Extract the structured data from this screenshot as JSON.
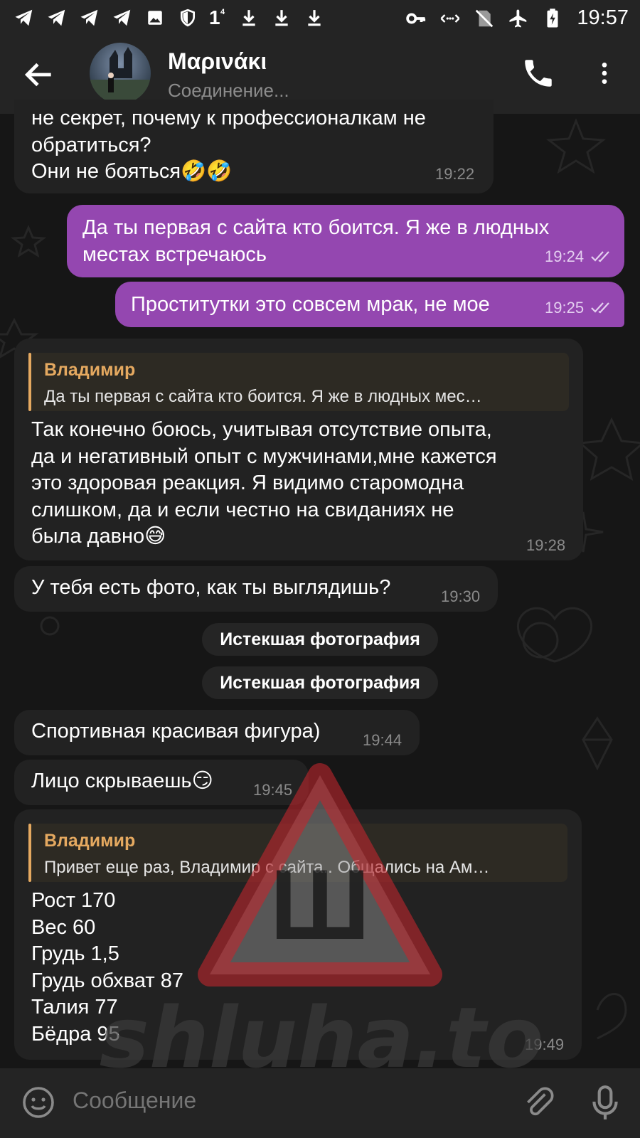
{
  "status_bar": {
    "time": "19:57",
    "signal_badge": "1",
    "signal_sup": "4",
    "icons_left": [
      "telegram-icon",
      "telegram-icon",
      "telegram-icon",
      "telegram-icon",
      "image-icon",
      "shield-icon",
      "signal-icon",
      "download-icon",
      "download-icon",
      "download-icon"
    ],
    "icons_right": [
      "key-icon",
      "data-transfer-icon",
      "no-sim-icon",
      "airplane-icon",
      "battery-charging-icon"
    ]
  },
  "header": {
    "name": "Μαρινάκι",
    "status": "Соединение..."
  },
  "messages": [
    {
      "dir": "in",
      "text": "не секрет, почему к профессионалкам не\nобратиться?\nОни не бояться",
      "emoji": "🤣🤣",
      "time": "19:22"
    },
    {
      "dir": "out",
      "text": "Да ты первая с сайта кто боится. Я же в людных\nместах встречаюсь",
      "time": "19:24"
    },
    {
      "dir": "out",
      "text": "Проститутки это совсем мрак, не мое",
      "time": "19:25"
    },
    {
      "dir": "in",
      "reply_name": "Владимир",
      "reply_text": "Да ты первая с сайта кто боится. Я же в людных мес…",
      "text": "Так конечно боюсь, учитывая отсутствие опыта,\nда и негативный опыт с мужчинами,мне кажется\nэто здоровая реакция. Я видимо старомодна\nслишком, да и если честно на свиданиях не\nбыла давно",
      "emoji": "😅",
      "time": "19:28"
    },
    {
      "dir": "in",
      "text": "У тебя есть фото, как ты выглядишь?",
      "time": "19:30"
    },
    {
      "dir": "service",
      "text": "Истекшая фотография"
    },
    {
      "dir": "service",
      "text": "Истекшая фотография"
    },
    {
      "dir": "in",
      "text": "Спортивная красивая фигура)",
      "time": "19:44"
    },
    {
      "dir": "in",
      "text": "Лицо скрываешь",
      "emoji": "😏",
      "time": "19:45"
    },
    {
      "dir": "in",
      "reply_name": "Владимир",
      "reply_text": "Привет еще раз, Владимир с сайта.. Общались на Ам…",
      "text": "Рост 170\nВес 60\nГрудь 1,5\nГрудь обхват 87\nТалия 77\nБёдра 95",
      "time": "19:49"
    }
  ],
  "watermark": {
    "text": "shluha.to",
    "letter": "Ш"
  },
  "input": {
    "placeholder": "Сообщение"
  },
  "colors": {
    "outgoing": "#9447b0",
    "incoming": "#222222",
    "reply_accent": "#e5a960",
    "bar": "#242424"
  }
}
